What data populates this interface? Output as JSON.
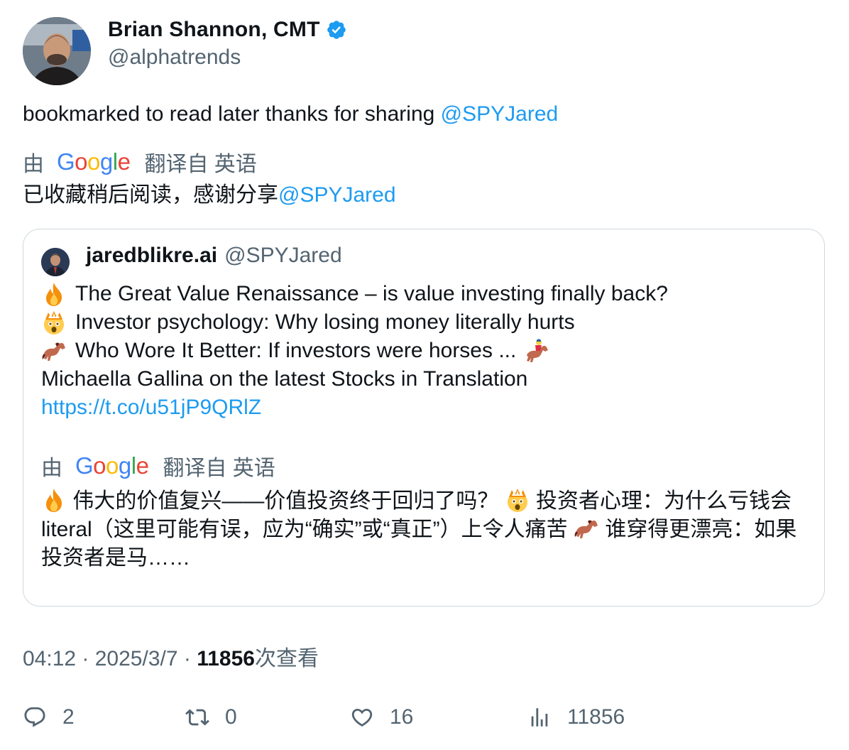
{
  "author": {
    "name": "Brian Shannon, CMT",
    "handle": "@alphatrends"
  },
  "tweet": {
    "text": "bookmarked to read later thanks for sharing ",
    "mention": "@SPYJared"
  },
  "translation": {
    "by": "由",
    "provider": "Google",
    "label": "翻译自 英语",
    "text": "已收藏稍后阅读，感谢分享",
    "mention": "@SPYJared"
  },
  "quoted": {
    "name": "jaredblikre.ai",
    "handle": "@SPYJared",
    "lines": [
      {
        "emoji": "fire-icon",
        "text": "The Great Value Renaissance – is value investing finally back?"
      },
      {
        "emoji": "exploding-head-icon",
        "text": "Investor psychology: Why losing money literally hurts"
      },
      {
        "emoji": "horse-icon",
        "text": "Who Wore It Better: If investors were horses ..."
      },
      {
        "emoji": "",
        "text": "Michaella Gallina on the latest Stocks in Translation"
      }
    ],
    "link": "https://t.co/u51jP9QRlZ",
    "translation": {
      "by": "由",
      "provider": "Google",
      "label": "翻译自 英语",
      "part1": "伟大的价值复兴——价值投资终于回归了吗？",
      "part2": "投资者心理：为什么亏钱会 literal（这里可能有误，应为“确实”或“真正”）上令人痛苦",
      "part3": "谁穿得更漂亮：如果投资者是马……"
    }
  },
  "meta": {
    "time": "04:12",
    "sep1": " · ",
    "date": "2025/3/7",
    "sep2": " · ",
    "views": "11856",
    "views_label": "次查看"
  },
  "actions": {
    "replies": "2",
    "retweets": "0",
    "likes": "16",
    "views": "11856"
  },
  "colors": {
    "accent": "#1d9bf0",
    "secondary_text": "#536471",
    "border": "#cfd9de"
  }
}
